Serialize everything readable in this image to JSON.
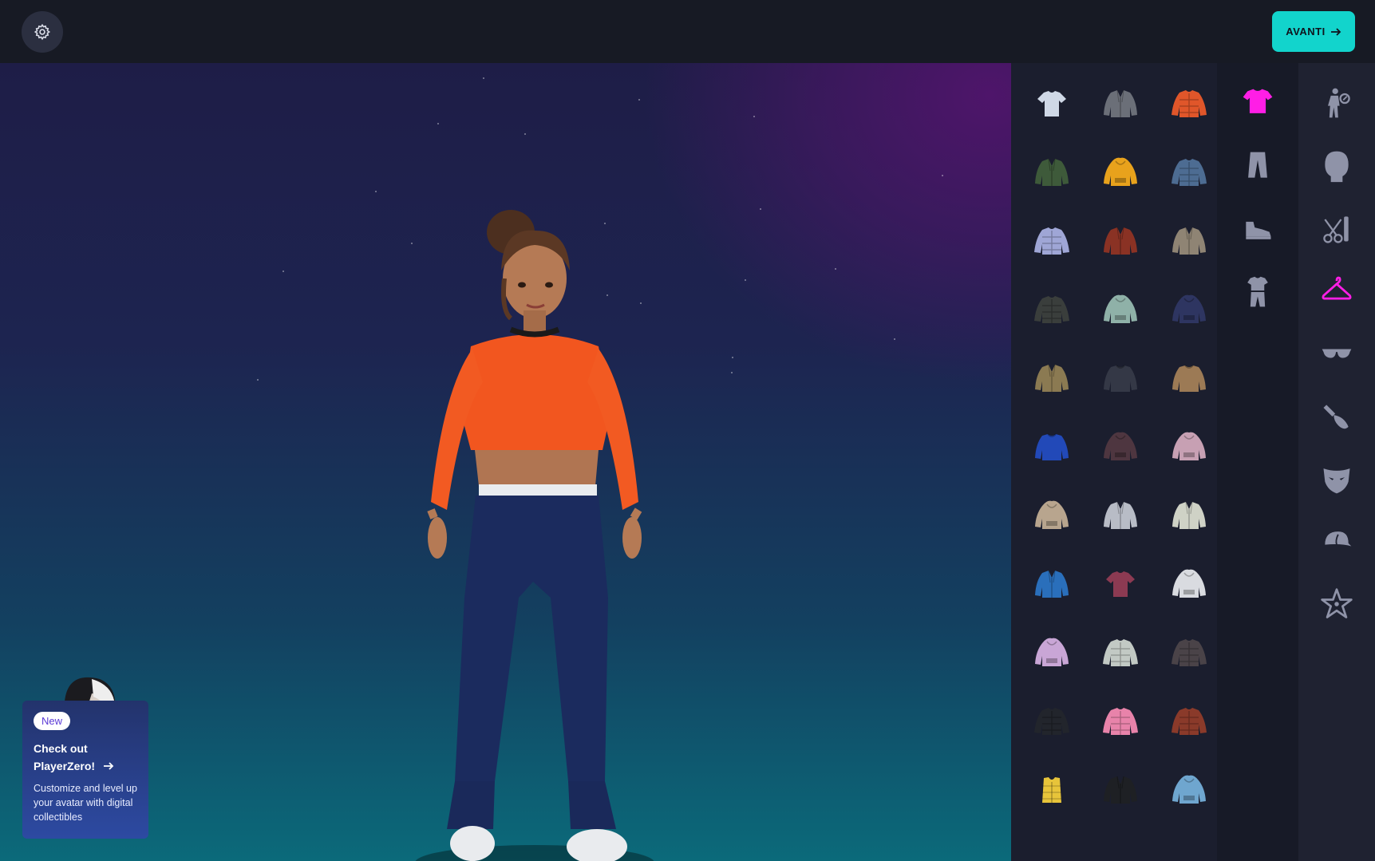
{
  "header": {
    "settings_icon": "gear-icon",
    "next_button_label": "AVANTI",
    "next_icon": "arrow-right-icon",
    "accent_color": "#12d4cc"
  },
  "promo": {
    "badge": "New",
    "title_line1": "Check out",
    "title_line2": "PlayerZero!",
    "description": "Customize and level up your avatar with digital collectibles"
  },
  "items": [
    {
      "kind": "tshirt",
      "color": "#cfd8e6"
    },
    {
      "kind": "jacket",
      "color": "#6b6f78"
    },
    {
      "kind": "puffer",
      "color": "#e0562a"
    },
    {
      "kind": "jacket",
      "color": "#3e5a3a"
    },
    {
      "kind": "hoodie",
      "color": "#e8a21c"
    },
    {
      "kind": "puffer",
      "color": "#4d6c92"
    },
    {
      "kind": "puffer",
      "color": "#9fa6d6"
    },
    {
      "kind": "jacket",
      "color": "#8a3224"
    },
    {
      "kind": "jacket",
      "color": "#8f8474"
    },
    {
      "kind": "puffer",
      "color": "#3a3e3c"
    },
    {
      "kind": "hoodie",
      "color": "#8fb1a8"
    },
    {
      "kind": "hoodie",
      "color": "#2e3561"
    },
    {
      "kind": "jacket",
      "color": "#8b7a52"
    },
    {
      "kind": "sweater",
      "color": "#343846"
    },
    {
      "kind": "sweater",
      "color": "#9c7a55"
    },
    {
      "kind": "sweater",
      "color": "#2249b8"
    },
    {
      "kind": "hoodie",
      "color": "#4e3640"
    },
    {
      "kind": "hoodie",
      "color": "#c7a0b3"
    },
    {
      "kind": "hoodie",
      "color": "#b8a58e"
    },
    {
      "kind": "jacket",
      "color": "#b8bcc6"
    },
    {
      "kind": "jacket",
      "color": "#cfd2c6"
    },
    {
      "kind": "jacket",
      "color": "#2a6fbb"
    },
    {
      "kind": "tshirt",
      "color": "#8c3a52"
    },
    {
      "kind": "hoodie",
      "color": "#d9dbe0"
    },
    {
      "kind": "hoodie",
      "color": "#c9a6d6"
    },
    {
      "kind": "puffer",
      "color": "#c2c9c4"
    },
    {
      "kind": "puffer",
      "color": "#4a4348"
    },
    {
      "kind": "puffer",
      "color": "#22252c"
    },
    {
      "kind": "puffer",
      "color": "#e883aa"
    },
    {
      "kind": "puffer",
      "color": "#8a3a2a"
    },
    {
      "kind": "vest",
      "color": "#e7c43a"
    },
    {
      "kind": "jacket",
      "color": "#1e2024"
    },
    {
      "kind": "hoodie",
      "color": "#6fa6cf"
    }
  ],
  "subcategories": [
    {
      "name": "top-icon",
      "active": true
    },
    {
      "name": "pants-icon",
      "active": false
    },
    {
      "name": "shoe-icon",
      "active": false
    },
    {
      "name": "outfit-icon",
      "active": false
    }
  ],
  "categories": [
    {
      "name": "body-type-icon",
      "active": false
    },
    {
      "name": "head-icon",
      "active": false
    },
    {
      "name": "hair-styling-icon",
      "active": false
    },
    {
      "name": "clothing-hanger-icon",
      "active": true
    },
    {
      "name": "glasses-icon",
      "active": false
    },
    {
      "name": "makeup-brush-icon",
      "active": false
    },
    {
      "name": "mask-icon",
      "active": false
    },
    {
      "name": "cap-icon",
      "active": false
    },
    {
      "name": "favorites-star-icon",
      "active": false
    }
  ],
  "colors": {
    "active_icon": "#ff1ee6",
    "inactive_icon": "#8f93a8"
  }
}
